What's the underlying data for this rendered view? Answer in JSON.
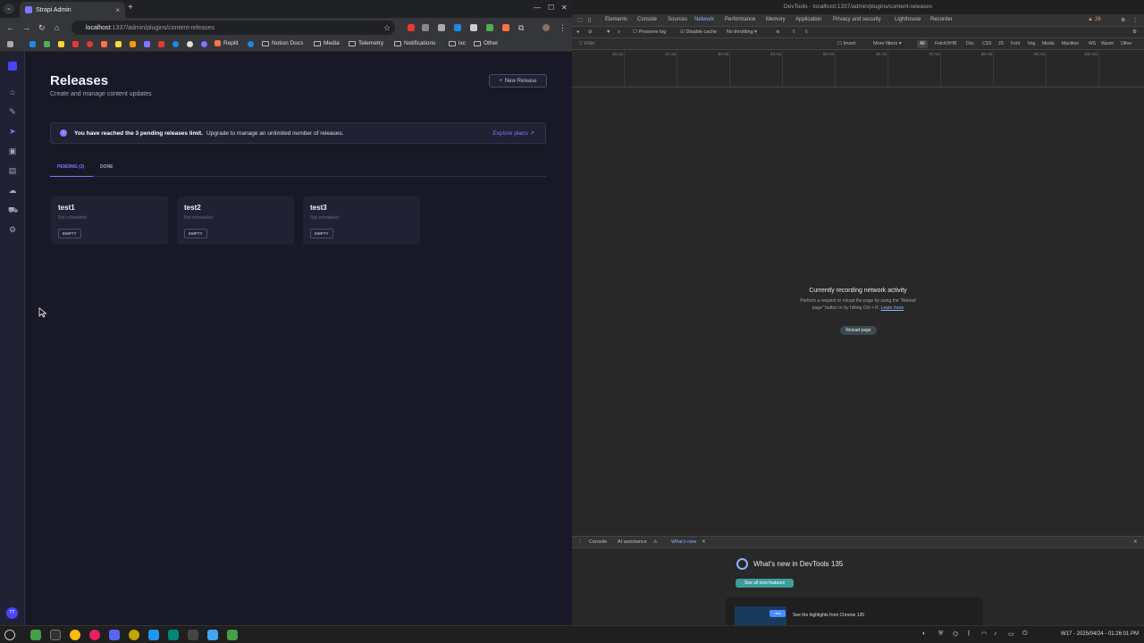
{
  "browser": {
    "tab_title": "Strapi Admin",
    "tab_close": "×",
    "new_tab": "+",
    "url_host": "localhost",
    "url_path": ":1337/admin/plugins/content-releases",
    "bookmarks": [
      "Replit",
      "Notion Docs",
      "Media",
      "Telemetry",
      "Notifications",
      "lxc",
      "Other"
    ]
  },
  "strapi": {
    "page_title": "Releases",
    "page_subtitle": "Create and manage content updates",
    "new_release_label": "New Release",
    "banner_bold": "You have reached the 3 pending releases limit.",
    "banner_text": "Upgrade to manage an unlimited number of releases.",
    "explore_plans": "Explore plans",
    "tabs": {
      "pending": "PENDING (3)",
      "done": "DONE"
    },
    "releases": [
      {
        "name": "test1",
        "schedule": "Not scheduled",
        "status": "EMPTY"
      },
      {
        "name": "test2",
        "schedule": "Not scheduled",
        "status": "EMPTY"
      },
      {
        "name": "test3",
        "schedule": "Not scheduled",
        "status": "EMPTY"
      }
    ],
    "avatar_initials": "TT",
    "accent": "#4945ff"
  },
  "devtools": {
    "title": "DevTools - localhost:1337/admin/plugins/content-releases",
    "tabs": [
      "Elements",
      "Console",
      "Sources",
      "Network",
      "Performance",
      "Memory",
      "Application",
      "Privacy and security",
      "Lighthouse",
      "Recorder"
    ],
    "active_tab": "Network",
    "issues_count": "26",
    "toolbar": {
      "preserve_log": "Preserve log",
      "disable_cache": "Disable cache",
      "throttling": "No throttling"
    },
    "filter_placeholder": "Filter",
    "invert": "Invert",
    "more_filters": "More filters",
    "filter_chips": [
      "All",
      "Fetch/XHR",
      "Doc",
      "CSS",
      "JS",
      "Font",
      "Img",
      "Media",
      "Manifest",
      "WS",
      "Wasm",
      "Other"
    ],
    "timeline_ticks": [
      "10 ms",
      "20 ms",
      "30 ms",
      "40 ms",
      "50 ms",
      "60 ms",
      "70 ms",
      "80 ms",
      "90 ms",
      "100 ms"
    ],
    "recording_title": "Currently recording network activity",
    "recording_desc": "Perform a request or reload the page by using the \"Reload page\" button or by hitting Ctrl + R.",
    "learn_more": "Learn more",
    "reload_button": "Reload page",
    "drawer_tabs": [
      "Console",
      "AI assistance",
      "What's new"
    ],
    "whats_new_title": "What's new in DevTools 135",
    "whats_new_button": "See all new features",
    "whats_new_badge": "new",
    "whats_new_card": "See the highlights from Chrome 135"
  },
  "taskbar": {
    "clock": "W17 - 2025/04/24 - 01:26:01 PM"
  }
}
